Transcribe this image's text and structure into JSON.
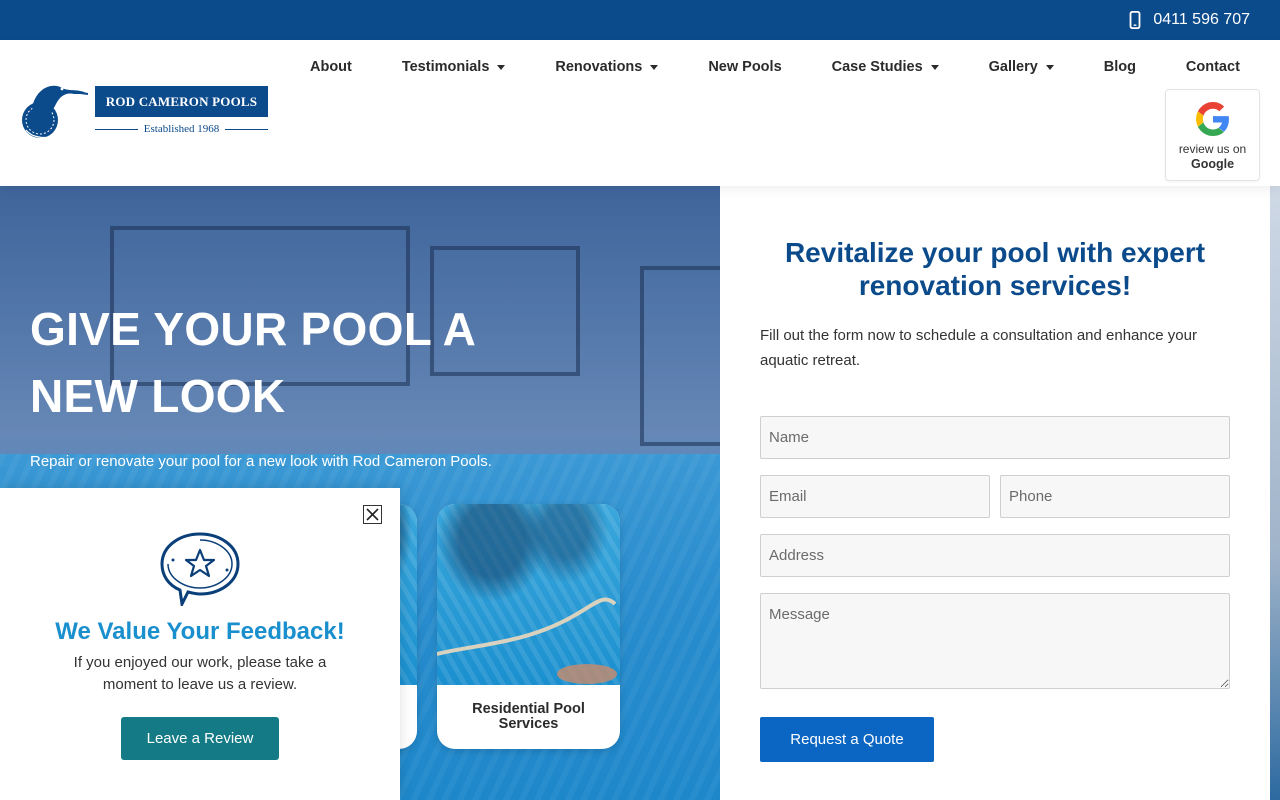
{
  "topbar": {
    "phone_icon": "mobile-phone-icon",
    "phone": "0411 596 707"
  },
  "brand": {
    "name": "ROD CAMERON POOLS",
    "established": "Established 1968",
    "emblem_text": "ROD CAMERON POOLS",
    "color": "#0b4a8b"
  },
  "nav": {
    "items": [
      {
        "label": "About",
        "dropdown": false
      },
      {
        "label": "Testimonials",
        "dropdown": true
      },
      {
        "label": "Renovations",
        "dropdown": true
      },
      {
        "label": "New Pools",
        "dropdown": false
      },
      {
        "label": "Case Studies",
        "dropdown": true
      },
      {
        "label": "Gallery",
        "dropdown": true
      },
      {
        "label": "Blog",
        "dropdown": false
      },
      {
        "label": "Contact",
        "dropdown": false
      }
    ]
  },
  "google_badge": {
    "line1": "review us on",
    "line2": "Google"
  },
  "hero": {
    "title": "GIVE YOUR POOL A NEW LOOK",
    "subtitle": "Repair or renovate your pool for a new look with Rod Cameron Pools.",
    "cards": [
      {
        "label": "Residential Pool Services"
      }
    ]
  },
  "form": {
    "title": "Revitalize your pool with expert renovation services!",
    "description": "Fill out the form now to schedule a consultation and enhance your aquatic retreat.",
    "name_placeholder": "Name",
    "email_placeholder": "Email",
    "phone_placeholder": "Phone",
    "address_placeholder": "Address",
    "message_placeholder": "Message",
    "submit_label": "Request a Quote",
    "accent": "#0a66c2"
  },
  "popup": {
    "title": "We Value Your Feedback!",
    "text": "If you enjoyed our work, please take a moment to leave us a review.",
    "button": "Leave a Review",
    "icon": "star-speech-bubble-icon",
    "close_icon": "close-icon",
    "title_color": "#1a8fce",
    "button_color": "#137a86"
  }
}
